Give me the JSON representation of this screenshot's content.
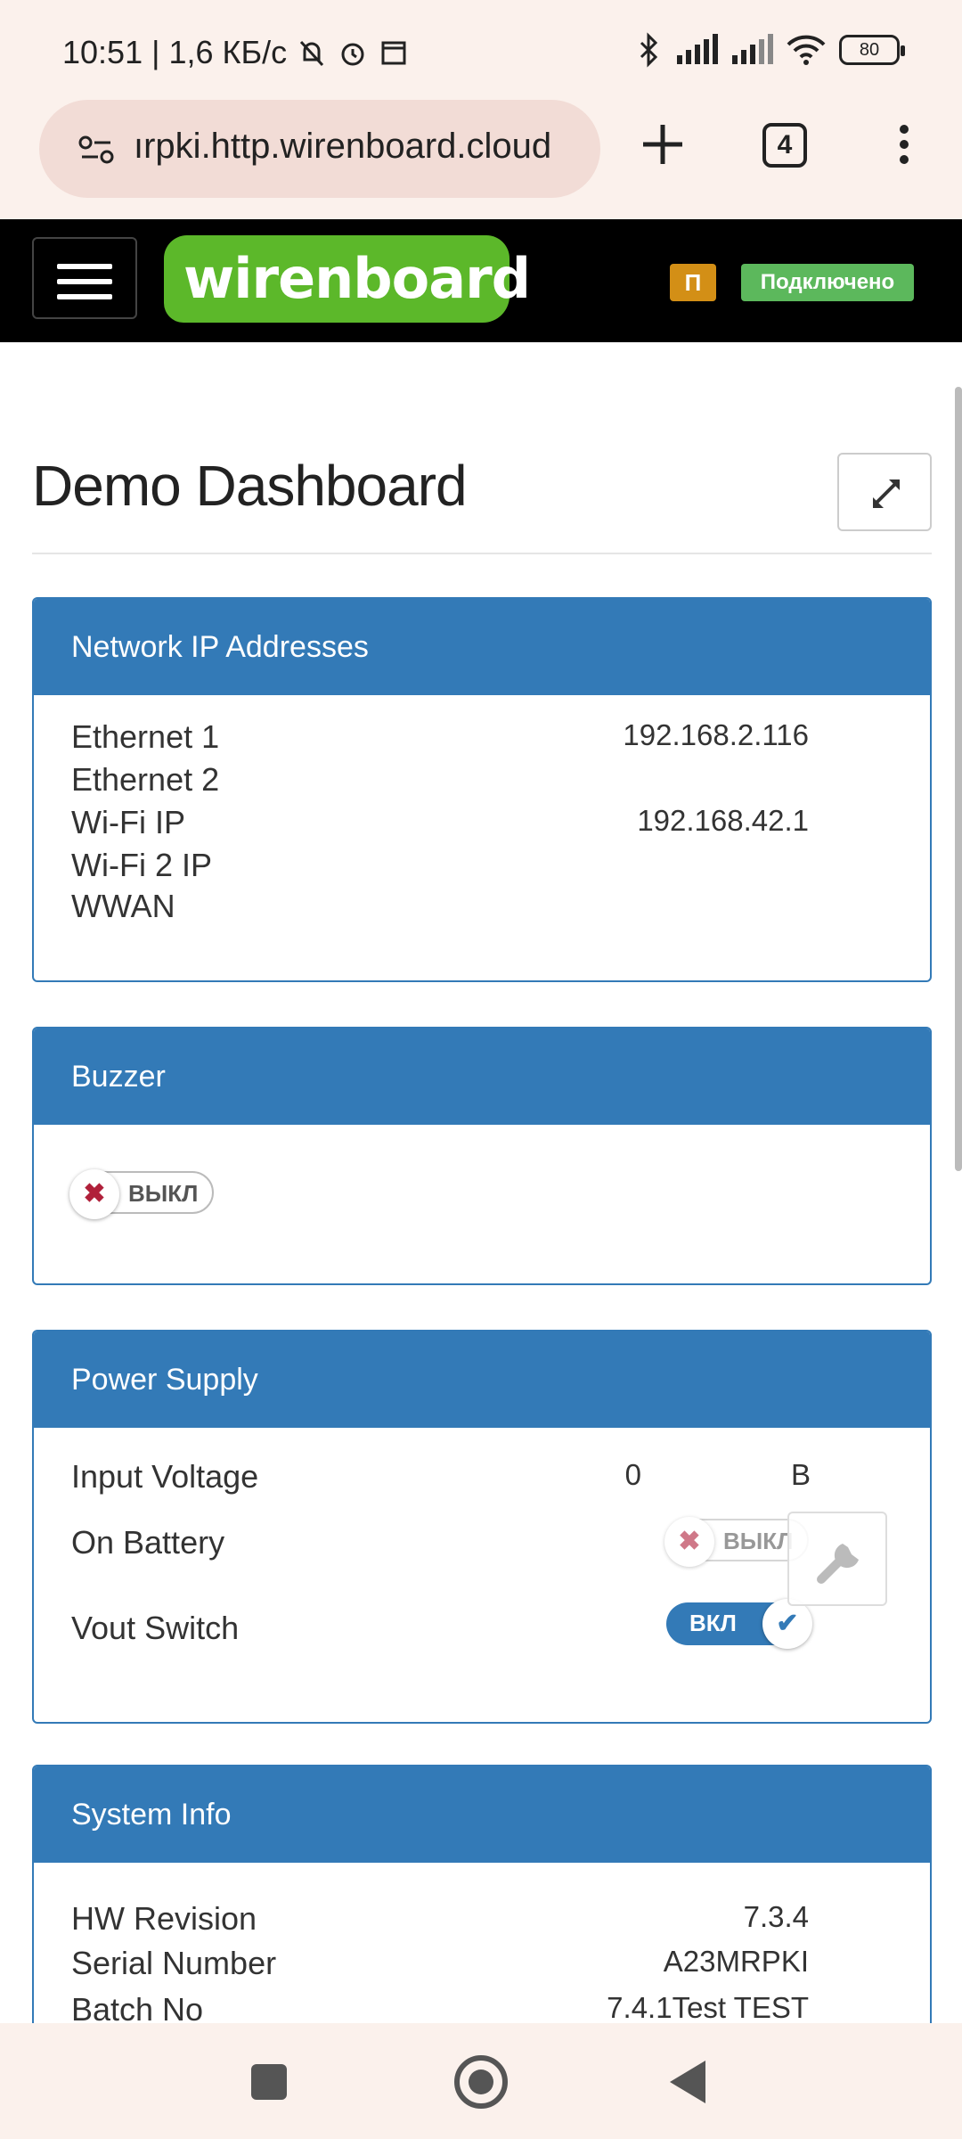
{
  "status_bar": {
    "time_and_speed": "10:51 | 1,6 КБ/с",
    "battery_level": "80",
    "icons": [
      "mute-icon",
      "alarm-icon",
      "calendar-icon",
      "bluetooth-icon",
      "signal-icon",
      "signal-icon",
      "wifi-icon",
      "battery-icon"
    ]
  },
  "browser": {
    "url": "wirenboard.cloud.http.irpki",
    "url_display": "ırpki.http.wirenboard.cloud",
    "tab_count": "4"
  },
  "navbar": {
    "logo_text": "wirenboard",
    "badge_p": "П",
    "connection_status": "Подключено",
    "colors": {
      "logo_green": "#5cb82a",
      "badge_orange": "#d38f16",
      "status_green": "#5cb85c"
    }
  },
  "page": {
    "title": "Demo Dashboard"
  },
  "panels": {
    "network": {
      "title": "Network IP Addresses",
      "rows": [
        {
          "label": "Ethernet 1",
          "value": "192.168.2.116"
        },
        {
          "label": "Ethernet 2",
          "value": ""
        },
        {
          "label": "Wi-Fi IP",
          "value": "192.168.42.1"
        },
        {
          "label": "Wi-Fi 2 IP",
          "value": ""
        },
        {
          "label": "WWAN",
          "value": ""
        }
      ]
    },
    "buzzer": {
      "title": "Buzzer",
      "toggle_label": "ВЫКЛ",
      "toggle_state": "off"
    },
    "power": {
      "title": "Power Supply",
      "input_voltage_label": "Input Voltage",
      "input_voltage_value": "0",
      "input_voltage_unit": "В",
      "on_battery_label": "On Battery",
      "on_battery_toggle": "ВЫКЛ",
      "vout_label": "Vout Switch",
      "vout_toggle": "ВКЛ"
    },
    "system": {
      "title": "System Info",
      "rows": [
        {
          "label": "HW Revision",
          "value": "7.3.4"
        },
        {
          "label": "Serial Number",
          "value": "A23MRPKI"
        },
        {
          "label": "Batch No",
          "value": "7.4.1Test TEST"
        }
      ]
    }
  },
  "theme": {
    "accent": "#337ab7"
  }
}
